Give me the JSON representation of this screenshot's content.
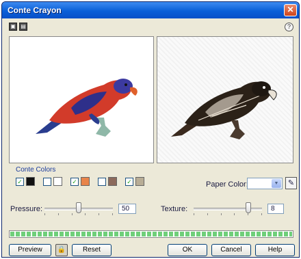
{
  "window": {
    "title": "Conte Crayon",
    "close_glyph": "✕"
  },
  "toolbar": {
    "btn1": "▣",
    "btn2": "▤",
    "help_glyph": "?"
  },
  "color_group": {
    "label": "Conte Colors",
    "swatches": [
      {
        "checked": true,
        "color": "#111111"
      },
      {
        "checked": false,
        "color": "#ffffff"
      },
      {
        "checked": true,
        "color": "#e8844a"
      },
      {
        "checked": false,
        "color": "#8c6a5c"
      },
      {
        "checked": true,
        "color": "#b8ad96"
      }
    ],
    "check_glyph": "✓"
  },
  "paper_color": {
    "label": "Paper Color:",
    "value": "",
    "arrow": "▼",
    "eyedropper_glyph": "✎"
  },
  "pressure": {
    "label": "Pressure:",
    "value": "50",
    "level": 0.5
  },
  "texture": {
    "label": "Texture:",
    "value": "8",
    "level": 0.8
  },
  "progress": {
    "level": 1.0
  },
  "buttons": {
    "preview": "Preview",
    "lock_glyph": "🔒",
    "reset": "Reset",
    "ok": "OK",
    "cancel": "Cancel",
    "help": "Help"
  }
}
